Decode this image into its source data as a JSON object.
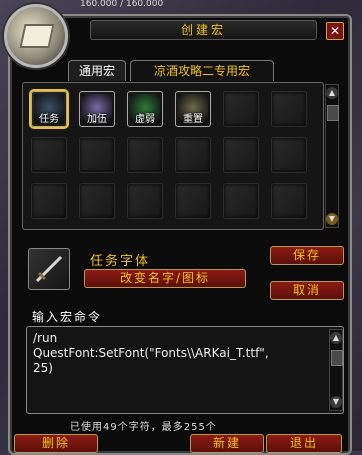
{
  "top_status": "160.000 / 160.000",
  "window": {
    "title": "创建宏",
    "close_icon": "close-icon"
  },
  "tabs": [
    {
      "label": "通用宏",
      "active": true
    },
    {
      "label": "凉酒攻略二专用宏",
      "active": false
    }
  ],
  "macro_slots": [
    {
      "label": "任务",
      "icon": "dagger-icon",
      "color": "#3a4f66",
      "selected": true
    },
    {
      "label": "加伍",
      "icon": "spark-icon",
      "color": "#7a6aa8",
      "selected": false
    },
    {
      "label": "虚弱",
      "icon": "swirl-icon",
      "color": "#2f7a3a",
      "selected": false
    },
    {
      "label": "重置",
      "icon": "scroll-icon",
      "color": "#6f6a4a",
      "selected": false
    }
  ],
  "selected_macro": {
    "name": "任务字体",
    "icon": "dagger-icon"
  },
  "buttons": {
    "save": "保存",
    "change_name_icon": "改变名字/图标",
    "cancel": "取消",
    "delete": "删除",
    "new": "新建",
    "exit": "退出"
  },
  "edit_label": "输入宏命令",
  "macro_text": "/run\nQuestFont:SetFont(\"Fonts\\\\ARKai_T.ttf\",\n25)",
  "char_count": "已使用49个字符，最多255个",
  "colors": {
    "accent": "#f1c21a",
    "button_red": "#8c1b14"
  }
}
